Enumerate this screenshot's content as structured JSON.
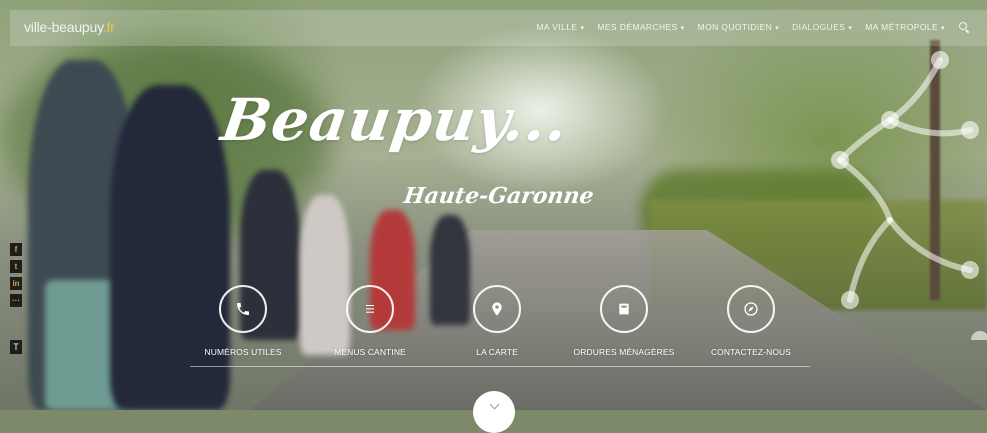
{
  "site": {
    "logo_prefix": "ville-beaupuy",
    "logo_suffix": ".fr"
  },
  "nav": {
    "items": [
      {
        "label": "MA VILLE"
      },
      {
        "label": "MES DÉMARCHES"
      },
      {
        "label": "MON QUOTIDIEN"
      },
      {
        "label": "DIALOGUES"
      },
      {
        "label": "MA MÉTROPOLE"
      }
    ],
    "search_icon": "search-icon"
  },
  "hero": {
    "title": "Beaupuy...",
    "subtitle": "Haute-Garonne"
  },
  "social": {
    "items": [
      {
        "icon": "facebook-icon",
        "glyph": "f"
      },
      {
        "icon": "twitter-icon",
        "glyph": "t"
      },
      {
        "icon": "linkedin-icon",
        "glyph": "in"
      },
      {
        "icon": "share-icon",
        "glyph": "···"
      }
    ],
    "extra": {
      "icon": "print-icon",
      "glyph": "T"
    }
  },
  "quick_links": [
    {
      "label": "NUMÉROS UTILES",
      "icon": "phone-icon"
    },
    {
      "label": "MENUS CANTINE",
      "icon": "menu-icon"
    },
    {
      "label": "LA CARTE",
      "icon": "map-pin-icon"
    },
    {
      "label": "ORDURES MÉNAGÈRES",
      "icon": "bin-icon"
    },
    {
      "label": "CONTACTEZ-NOUS",
      "icon": "compass-icon"
    }
  ],
  "colors": {
    "accent": "#f2c94c",
    "social_bg": "#1f1e1c",
    "social_glyph": "#d4a43c"
  }
}
